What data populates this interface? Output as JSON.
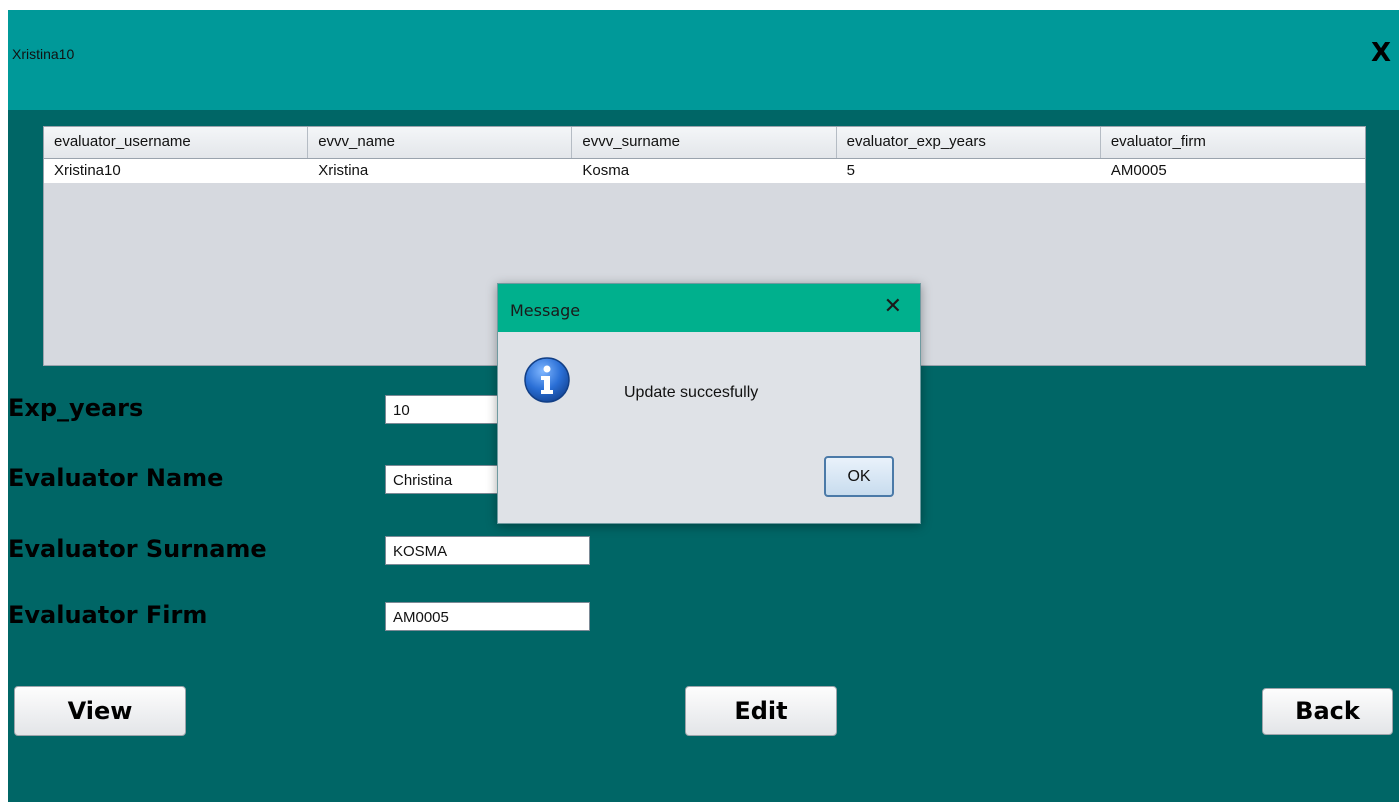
{
  "window": {
    "username": "Xristina10",
    "close_label": "X"
  },
  "table": {
    "columns": [
      "evaluator_username",
      "evvv_name",
      "evvv_surname",
      "evaluator_exp_years",
      "evaluator_firm"
    ],
    "rows": [
      [
        "Xristina10",
        "Xristina",
        "Kosma",
        "5",
        "AM0005"
      ]
    ]
  },
  "form": {
    "exp_years": {
      "label": "Exp_years",
      "value": "10"
    },
    "evaluator_name": {
      "label": "Evaluator Name",
      "value": "Christina"
    },
    "evaluator_surname": {
      "label": "Evaluator Surname",
      "value": "KOSMA"
    },
    "evaluator_firm": {
      "label": "Evaluator Firm",
      "value": "AM0005"
    }
  },
  "buttons": {
    "view": "View",
    "edit": "Edit",
    "back": "Back"
  },
  "dialog": {
    "title": "Message",
    "close_label": "✕",
    "message": "Update succesfully",
    "ok_label": "OK",
    "icon": "info-icon"
  },
  "colors": {
    "header_bar": "#009999",
    "background": "#006666",
    "dialog_title": "#00b08d"
  }
}
